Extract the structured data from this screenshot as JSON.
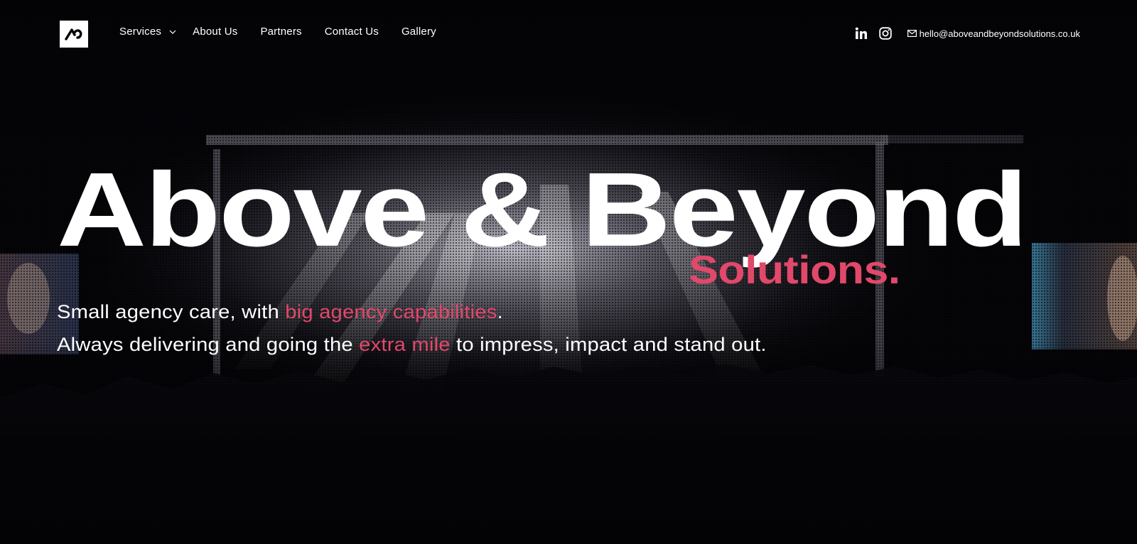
{
  "nav": {
    "logo_name": "above-beyond-logo",
    "links": [
      {
        "label": "Services",
        "has_dropdown": true
      },
      {
        "label": "About Us"
      },
      {
        "label": "Partners"
      },
      {
        "label": "Contact Us"
      },
      {
        "label": "Gallery"
      }
    ],
    "social": [
      "linkedin-icon",
      "instagram-icon"
    ],
    "email": "hello@aboveandbeyondsolutions.co.uk"
  },
  "hero": {
    "title": "Above & Beyond",
    "subtitle": "Solutions.",
    "tagline_1": {
      "pre": "Small agency care, with ",
      "highlight": "big agency capabilities",
      "post": "."
    },
    "tagline_2": {
      "pre": "Always delivering and going the ",
      "highlight": "extra mile",
      "post": " to impress, impact and stand out."
    }
  },
  "colors": {
    "accent": "#e2486a",
    "background": "#050508",
    "text": "#ffffff"
  }
}
